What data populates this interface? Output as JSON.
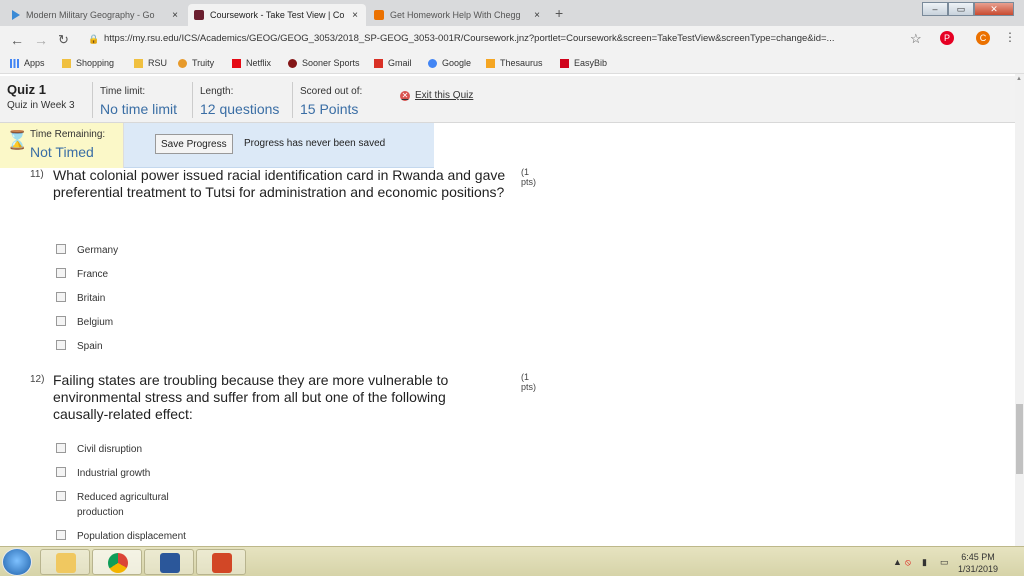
{
  "browser": {
    "tabs": [
      {
        "label": "Modern Military Geography - Go",
        "close": "×"
      },
      {
        "label": "Coursework - Take Test View | Co",
        "close": "×"
      },
      {
        "label": "Get Homework Help With Chegg",
        "close": "×"
      }
    ],
    "url": "https://my.rsu.edu/ICS/Academics/GEOG/GEOG_3053/2018_SP-GEOG_3053-001R/Coursework.jnz?portlet=Coursework&screen=TakeTestView&screenType=change&id=...",
    "bookmarks": [
      "Apps",
      "Shopping",
      "RSU",
      "Truity",
      "Netflix",
      "Sooner Sports",
      "Gmail",
      "Google",
      "Thesaurus",
      "EasyBib"
    ]
  },
  "quiz": {
    "title": "Quiz 1",
    "subtitle": "Quiz in Week 3",
    "time_limit_label": "Time limit:",
    "time_limit_value": "No time limit",
    "length_label": "Length:",
    "length_value": "12 questions",
    "score_label": "Scored out of:",
    "score_value": "15 Points",
    "exit_label": "Exit this Quiz",
    "time_remaining_label": "Time Remaining:",
    "time_remaining_value": "Not Timed",
    "save_button": "Save Progress",
    "save_status": "Progress has never been saved"
  },
  "questions": [
    {
      "number": "11)",
      "text": "What colonial power issued racial identification card in Rwanda and gave preferential treatment to Tutsi for administration and economic positions?",
      "points": "(1 pts)",
      "options": [
        "Germany",
        "France",
        "Britain",
        "Belgium",
        "Spain"
      ]
    },
    {
      "number": "12)",
      "text": "Failing states are troubling because they are more vulnerable to environmental stress and suffer from all but one of the following causally-related effect:",
      "points": "(1 pts)",
      "options": [
        "Civil disruption",
        "Industrial growth",
        "Reduced agricultural production",
        "Population displacement"
      ]
    }
  ],
  "taskbar": {
    "time": "6:45 PM",
    "date": "1/31/2019"
  },
  "colors": {
    "accent_blue": "#3a6ea5",
    "timer_bg": "#fbf8c8",
    "save_bg": "#dce9f7"
  }
}
